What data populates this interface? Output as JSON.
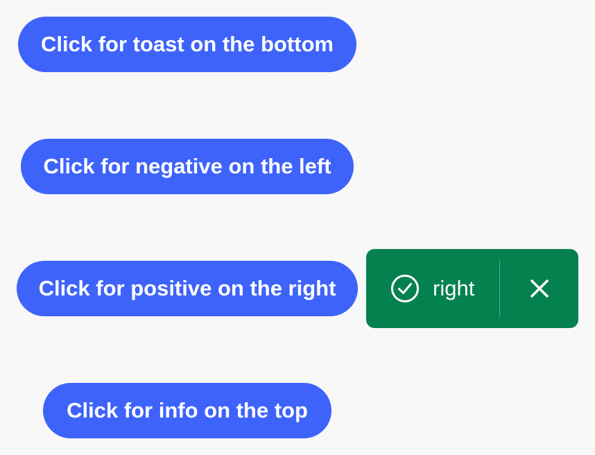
{
  "buttons": {
    "bottom": "Click for toast on the bottom",
    "left": "Click for negative on the left",
    "right": "Click for positive on the right",
    "top": "Click for info on the top"
  },
  "toast": {
    "variant": "positive",
    "message": "right",
    "status_icon": "checkmark-circle-icon",
    "close_icon": "close-icon",
    "background": "#05814f"
  },
  "colors": {
    "button": "#3e63fb",
    "page_background": "#f8f8f8"
  }
}
